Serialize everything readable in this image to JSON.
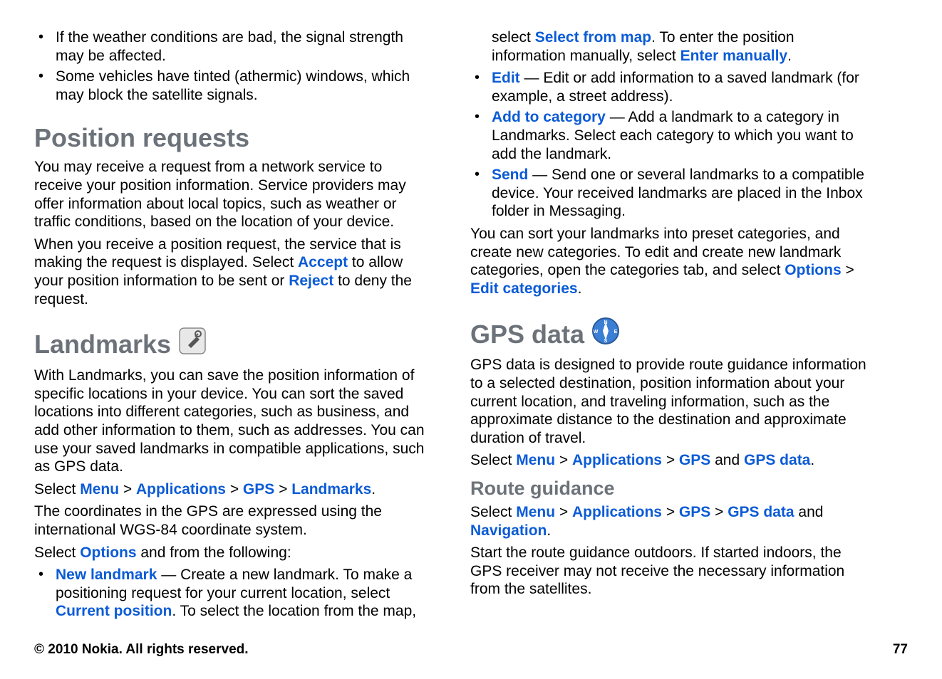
{
  "left": {
    "bullets_top": [
      "If the weather conditions are bad, the signal strength may be affected.",
      "Some vehicles have tinted (athermic) windows, which may block the satellite signals."
    ],
    "position_requests": {
      "heading": "Position requests",
      "p1": "You may receive a request from a network service to receive your position information. Service providers may offer information about local topics, such as weather or traffic conditions, based on the location of your device.",
      "p2_a": "When you receive a position request, the service that is making the request is displayed. Select ",
      "accept": "Accept",
      "p2_b": " to allow your position information to be sent or ",
      "reject": "Reject",
      "p2_c": " to deny the request."
    },
    "landmarks": {
      "heading": "Landmarks",
      "p1": "With Landmarks, you can save the position information of specific locations in your device. You can sort the saved locations into different categories, such as business, and add other information to them, such as addresses. You can use your saved landmarks in compatible applications, such as GPS data.",
      "nav": {
        "select": "Select ",
        "menu": "Menu",
        "gt1": " > ",
        "applications": "Applications",
        "gt2": " > ",
        "gps": "GPS",
        "gt3": " > ",
        "landmarks": "Landmarks",
        "end": "."
      },
      "p2": "The coordinates in the GPS are expressed using the international WGS-84 coordinate system.",
      "p3_a": "Select ",
      "options": "Options",
      "p3_b": " and from the following:",
      "new_landmark": {
        "label": "New landmark",
        "dash": "  —  ",
        "text_a": "Create a new landmark. To make a positioning request for your current location, select ",
        "current_position": "Current position",
        "text_b": ". To select the location from the map,"
      }
    }
  },
  "right": {
    "cont": {
      "text_a": "select ",
      "select_from_map": "Select from map",
      "text_b": ". To enter the position information manually, select ",
      "enter_manually": "Enter manually",
      "text_c": "."
    },
    "opts": [
      {
        "label": "Edit",
        "dash": "  —  ",
        "text": "Edit or add information to a saved landmark (for example, a street address)."
      },
      {
        "label": "Add to category",
        "dash": "  —  ",
        "text": "Add a landmark to a category in Landmarks. Select each category to which you want to add the landmark."
      },
      {
        "label": "Send",
        "dash": "  —  ",
        "text": "Send one or several landmarks to a compatible device. Your received landmarks are placed in the Inbox folder in Messaging."
      }
    ],
    "sort": {
      "text_a": "You can sort your landmarks into preset categories, and create new categories. To edit and create new landmark categories, open the categories tab, and select ",
      "options": "Options",
      "gt": " > ",
      "edit_categories": "Edit categories",
      "end": "."
    },
    "gps_data": {
      "heading": "GPS data",
      "p1": "GPS data is designed to provide route guidance information to a selected destination, position information about your current location, and traveling information, such as the approximate distance to the destination and approximate duration of travel.",
      "nav": {
        "select": "Select ",
        "menu": "Menu",
        "gt1": " > ",
        "applications": "Applications",
        "gt2": " > ",
        "gps": "GPS",
        "and": " and ",
        "gps_data": "GPS data",
        "end": "."
      }
    },
    "route_guidance": {
      "heading": "Route guidance",
      "nav": {
        "select": "Select ",
        "menu": "Menu",
        "gt1": " > ",
        "applications": "Applications",
        "gt2": " > ",
        "gps": "GPS",
        "gt3": " > ",
        "gps_data": "GPS data",
        "and": " and ",
        "navigation": "Navigation",
        "end": "."
      },
      "p1": "Start the route guidance outdoors. If started indoors, the GPS receiver may not receive the necessary information from the satellites."
    }
  },
  "footer": {
    "left": "© 2010 Nokia. All rights reserved.",
    "right": "77"
  }
}
